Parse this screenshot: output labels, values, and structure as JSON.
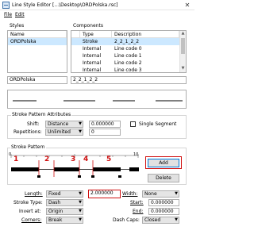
{
  "window": {
    "title": "Line Style Editor [...\\Desktop\\ORDPolska.rsc]"
  },
  "menu": [
    {
      "label": "File"
    },
    {
      "label": "Edit"
    }
  ],
  "styles": {
    "group_label": "Styles",
    "column_header": "Name",
    "items": [
      {
        "label": "ORDPolska"
      }
    ],
    "name_value": "ORDPolska"
  },
  "components": {
    "group_label": "Components",
    "column_headers": [
      "Type",
      "Description"
    ],
    "rows": [
      {
        "type": "Stroke",
        "description": "2_2_1_2_2"
      },
      {
        "type": "Internal",
        "description": "Line code 0"
      },
      {
        "type": "Internal",
        "description": "Line code 1"
      },
      {
        "type": "Internal",
        "description": "Line code 2"
      },
      {
        "type": "Internal",
        "description": "Line code 3"
      }
    ],
    "description_value": "2_2_1_2_2"
  },
  "attributes": {
    "group_label": "Stroke Pattern Attributes",
    "shift_label": "Shift:",
    "shift_value": "Distance",
    "shift_amount": "0.000000",
    "repetitions_label": "Repetitions:",
    "repetitions_value": "Unlimited",
    "repetitions_amount": "0",
    "single_segment_label": "Single Segment",
    "single_segment_checked": false
  },
  "stroke_pattern": {
    "group_label": "Stroke Pattern",
    "ruler_start": "0",
    "ruler_end": "10",
    "markers": [
      "1",
      "2",
      "3",
      "4",
      "5"
    ],
    "add_label": "Add",
    "delete_label": "Delete"
  },
  "properties": {
    "length_label": "Length:",
    "length_value": "Fixed",
    "length_amount": "2.000000",
    "width_label": "Width:",
    "width_value": "None",
    "stroke_type_label": "Stroke Type:",
    "stroke_type_value": "Dash",
    "start_label": "Start:",
    "start_value": "0.000000",
    "invert_label": "Invert at:",
    "invert_value": "Origin",
    "end_label": "End:",
    "end_value": "0.000000",
    "corners_label": "Corners:",
    "corners_value": "Break",
    "dash_caps_label": "Dash Caps:",
    "dash_caps_value": "Closed"
  },
  "colors": {
    "highlight": "#d01010",
    "selection": "#cce8ff",
    "accent": "#0078d7"
  }
}
